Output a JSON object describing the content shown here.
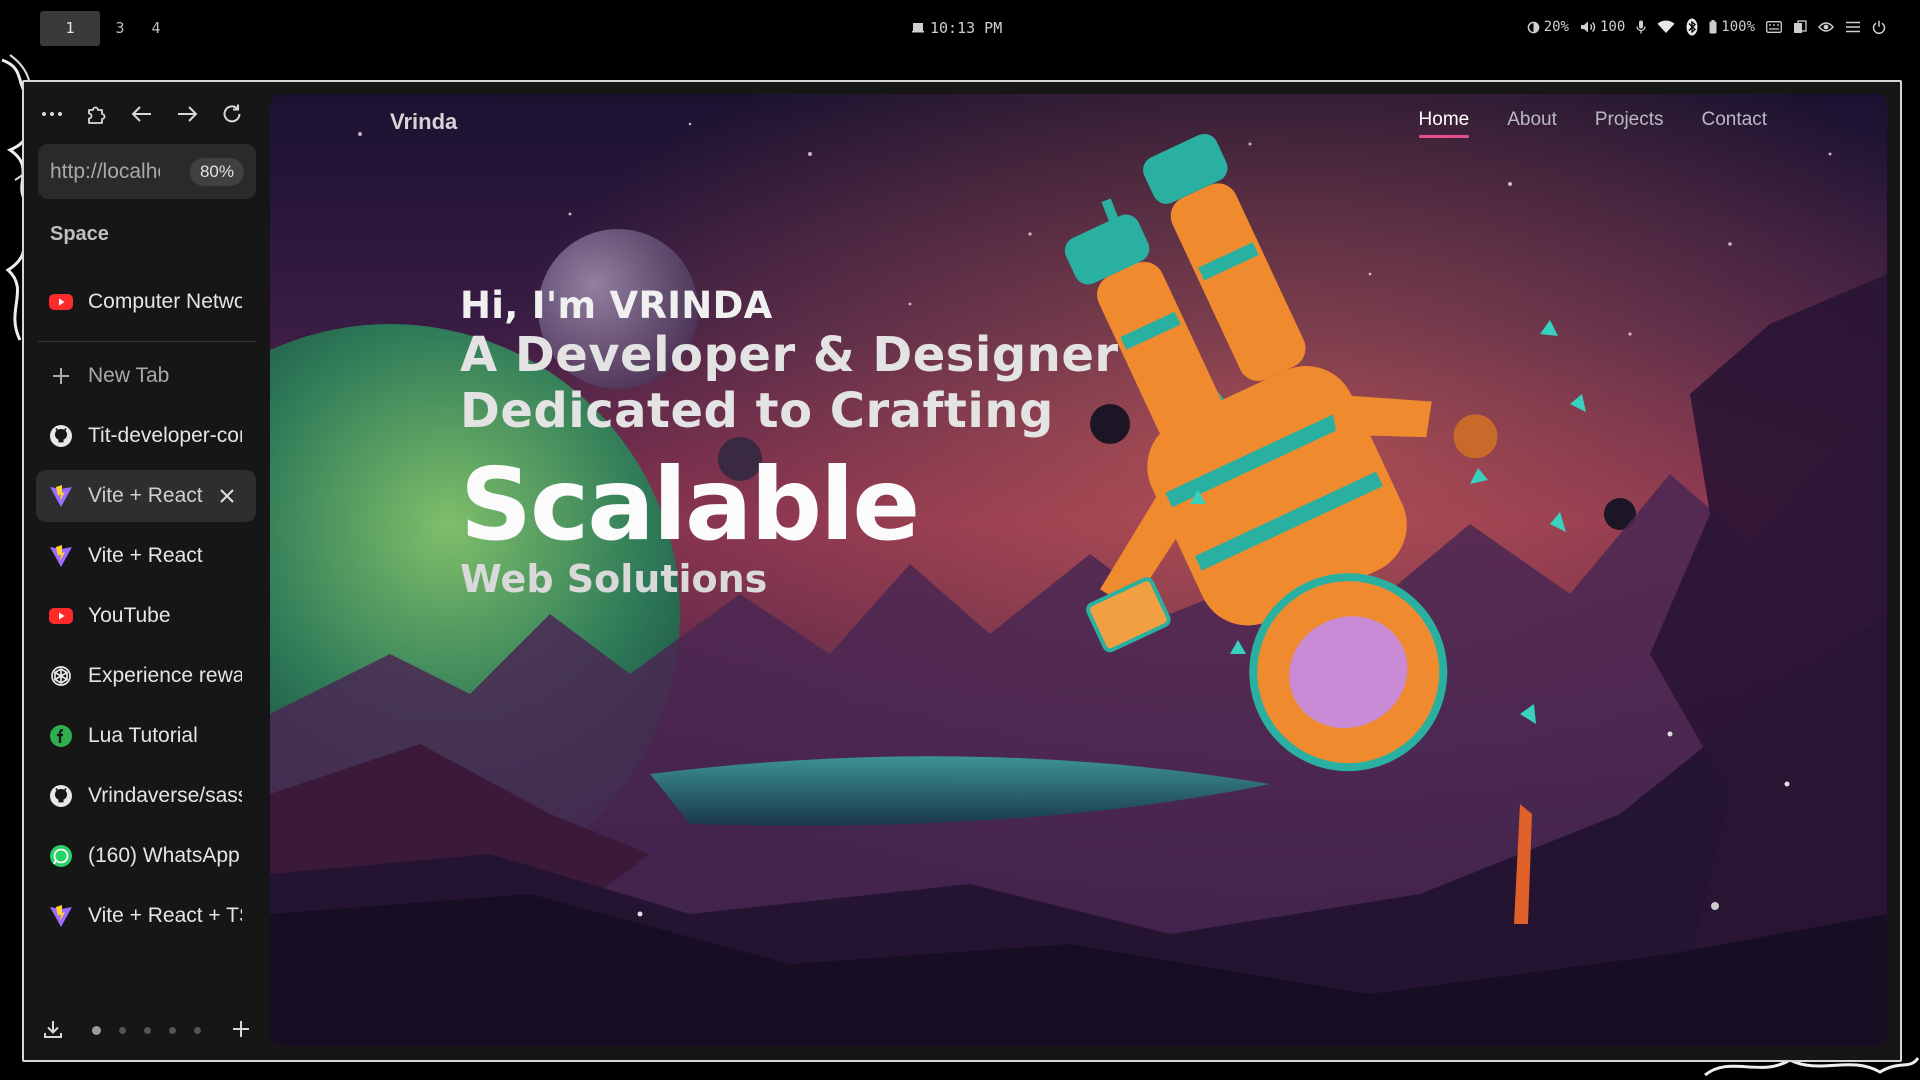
{
  "system_bar": {
    "workspaces": [
      {
        "label": "1",
        "active": true
      },
      {
        "label": "3",
        "active": false
      },
      {
        "label": "4",
        "active": false
      }
    ],
    "clock": "10:13 PM",
    "brightness": "20%",
    "volume": "100",
    "battery": "100%",
    "icons": [
      "brightness-icon",
      "volume-icon",
      "microphone-icon",
      "wifi-icon",
      "bluetooth-icon",
      "battery-icon",
      "keyboard-icon",
      "clipboard-icon",
      "eye-icon",
      "menu-icon",
      "power-icon"
    ]
  },
  "browser": {
    "url": "http://localhost",
    "zoom": "80%",
    "space_title": "Space",
    "pinned_tabs": [
      {
        "label": "Computer Networks",
        "icon": "youtube-icon"
      }
    ],
    "new_tab_label": "New Tab",
    "tabs": [
      {
        "label": "Tit-developer-community",
        "icon": "github-icon",
        "active": false
      },
      {
        "label": "Vite + React",
        "icon": "vite-icon",
        "active": true
      },
      {
        "label": "Vite + React",
        "icon": "vite-icon",
        "active": false
      },
      {
        "label": "YouTube",
        "icon": "youtube-icon",
        "active": false
      },
      {
        "label": "Experience rewards",
        "icon": "openai-icon",
        "active": false
      },
      {
        "label": "Lua Tutorial",
        "icon": "lua-icon",
        "active": false
      },
      {
        "label": "Vrindaverse/sass",
        "icon": "github-icon",
        "active": false
      },
      {
        "label": "(160) WhatsApp",
        "icon": "whatsapp-icon",
        "active": false
      },
      {
        "label": "Vite + React + TS",
        "icon": "vite-icon",
        "active": false
      }
    ],
    "colors": {
      "youtube": "#ff2a2a",
      "vite_a": "#9b6cff",
      "vite_b": "#ffd52b",
      "lua": "#2fae4e",
      "whatsapp": "#25d366"
    }
  },
  "site": {
    "logo": "Vrinda",
    "nav": [
      {
        "label": "Home",
        "active": true
      },
      {
        "label": "About",
        "active": false
      },
      {
        "label": "Projects",
        "active": false
      },
      {
        "label": "Contact",
        "active": false
      }
    ],
    "hero": {
      "greeting": "Hi, I'm VRINDA",
      "line1": "A Developer & Designer",
      "line2": "Dedicated to Crafting",
      "highlight": "Scalable",
      "line3": "Web Solutions"
    },
    "accent": "#e0508a"
  }
}
